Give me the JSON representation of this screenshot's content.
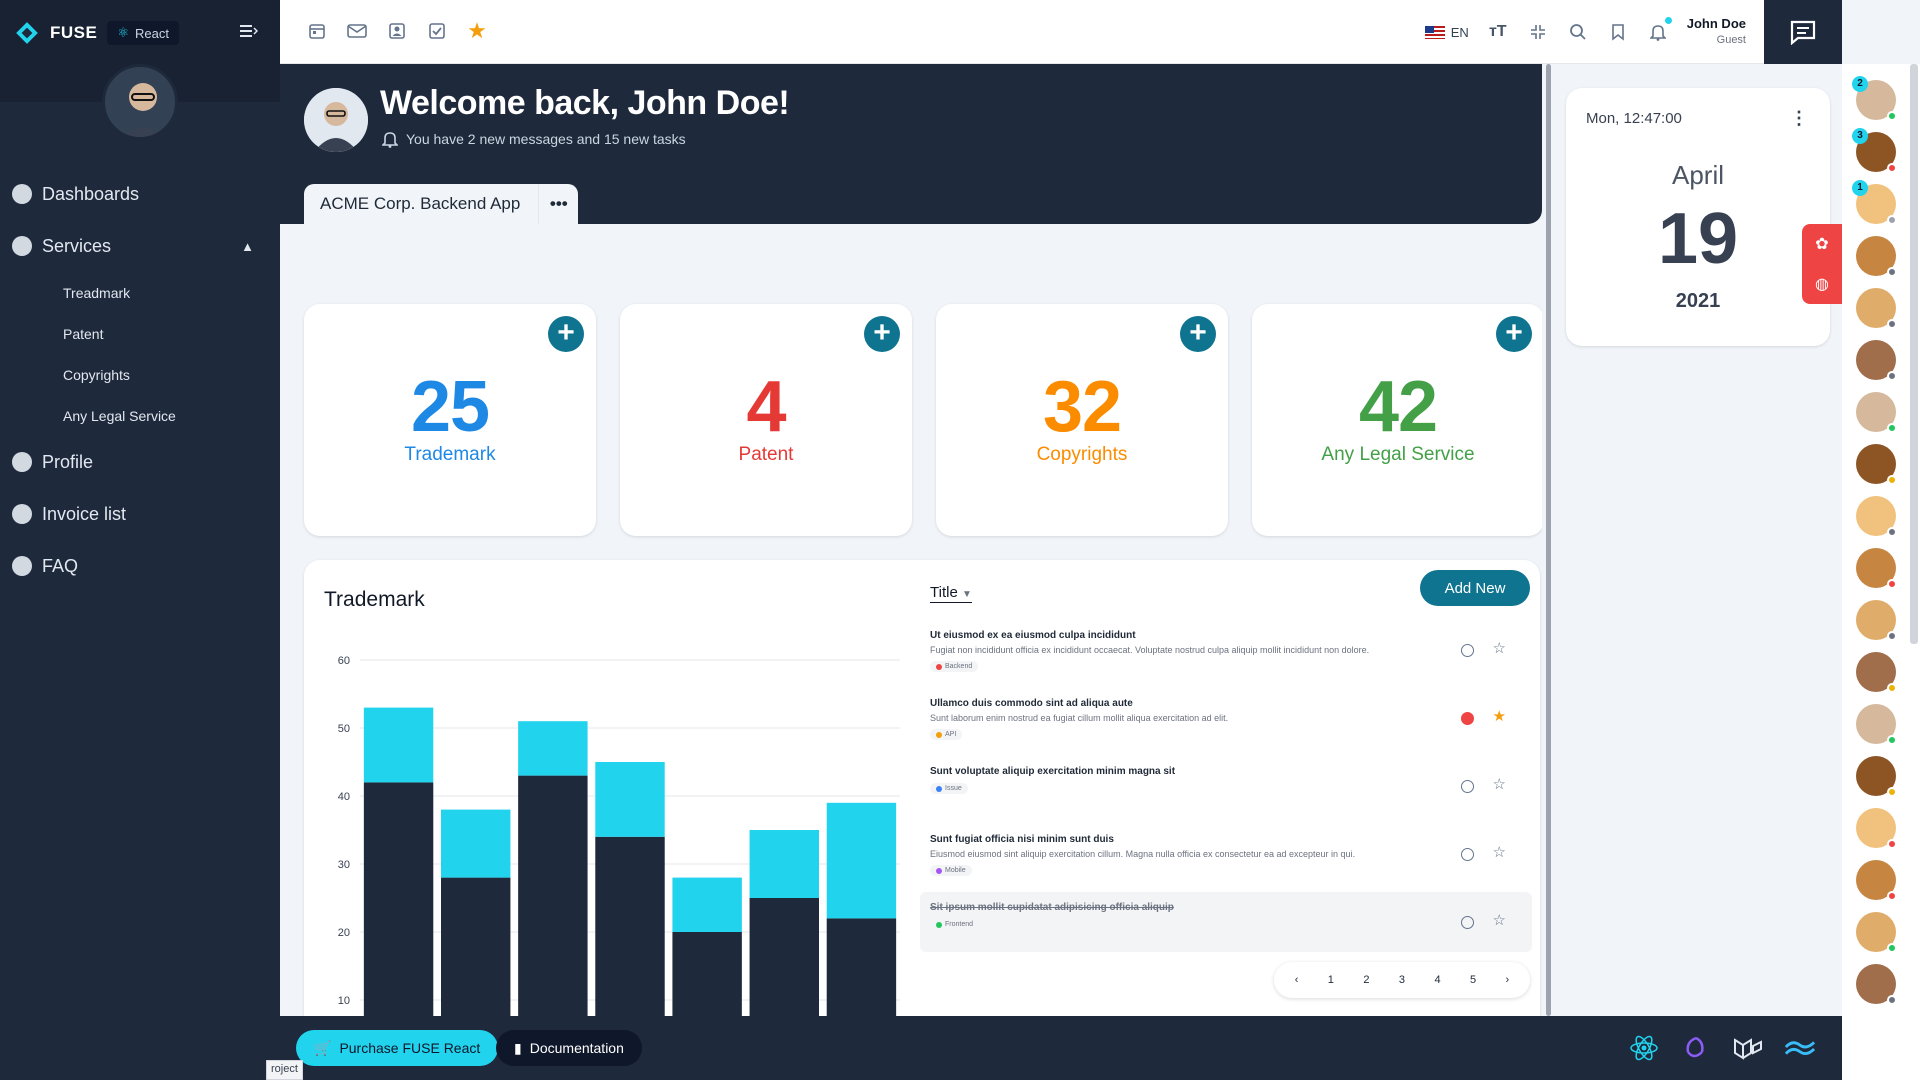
{
  "sidebar": {
    "brand": "FUSE",
    "badge": "React",
    "items": [
      {
        "label": "Dashboards"
      },
      {
        "label": "Services",
        "expanded": true
      },
      {
        "label": "Profile"
      },
      {
        "label": "Invoice list"
      },
      {
        "label": "FAQ"
      }
    ],
    "sub_items": [
      {
        "label": "Treadmark"
      },
      {
        "label": "Patent"
      },
      {
        "label": "Copyrights"
      },
      {
        "label": "Any Legal Service"
      }
    ]
  },
  "topbar": {
    "icons": [
      "calendar-icon",
      "mail-icon",
      "contacts-icon",
      "tasks-icon",
      "star-icon"
    ],
    "language": "EN",
    "user_name": "John Doe",
    "user_role": "Guest"
  },
  "hero": {
    "title": "Welcome back, John Doe!",
    "subtitle": "You have 2 new messages and 15 new tasks",
    "project": "ACME Corp. Backend App",
    "more": "•••"
  },
  "cards": [
    {
      "value": "25",
      "label": "Trademark",
      "color": "#1e88e5"
    },
    {
      "value": "4",
      "label": "Patent",
      "color": "#e53935"
    },
    {
      "value": "32",
      "label": "Copyrights",
      "color": "#fb8c00"
    },
    {
      "value": "42",
      "label": "Any Legal Service",
      "color": "#43a047"
    }
  ],
  "panel": {
    "title": "Trademark",
    "filter_label": "Title",
    "add_button": "Add New"
  },
  "chart_data": {
    "type": "bar",
    "stacked": true,
    "title": "",
    "xlabel": "",
    "ylabel": "",
    "ylim": [
      0,
      60
    ],
    "yticks": [
      10,
      20,
      30,
      40,
      50,
      60
    ],
    "grid": true,
    "series": [
      {
        "values": [
          42,
          28,
          43,
          34,
          20,
          25,
          22
        ],
        "color": "#1e293b"
      },
      {
        "values": [
          11,
          10,
          8,
          11,
          8,
          10,
          17
        ],
        "color": "#22d3ee"
      }
    ]
  },
  "tasks": [
    {
      "title": "Ut eiusmod ex ea eiusmod culpa incididunt",
      "desc": "Fugiat non incididunt officia ex incididunt occaecat. Voluptate nostrud culpa aliquip mollit incididunt non dolore.",
      "tag": "Backend",
      "tag_color": "#ef4444",
      "important": false,
      "starred": false,
      "done": false
    },
    {
      "title": "Ullamco duis commodo sint ad aliqua aute",
      "desc": "Sunt laborum enim nostrud ea fugiat cillum mollit aliqua exercitation ad elit.",
      "tag": "API",
      "tag_color": "#f59e0b",
      "important": true,
      "starred": true,
      "done": false
    },
    {
      "title": "Sunt voluptate aliquip exercitation minim magna sit",
      "desc": "",
      "tag": "Issue",
      "tag_color": "#3b82f6",
      "important": false,
      "starred": false,
      "done": false
    },
    {
      "title": "Sunt fugiat officia nisi minim sunt duis",
      "desc": "Eiusmod eiusmod sint aliquip exercitation cillum. Magna nulla officia ex consectetur ea ad excepteur in qui.",
      "tag": "Mobile",
      "tag_color": "#a855f7",
      "important": false,
      "starred": false,
      "done": false
    },
    {
      "title": "Sit ipsum mollit cupidatat adipisicing officia aliquip",
      "desc": "",
      "tag": "Frontend",
      "tag_color": "#22c55e",
      "important": false,
      "starred": false,
      "done": true
    }
  ],
  "pager": [
    "‹",
    "1",
    "2",
    "3",
    "4",
    "5",
    "›"
  ],
  "clock": {
    "time": "Mon, 12:47:00",
    "month": "April",
    "day": "19",
    "year": "2021"
  },
  "contacts": [
    {
      "badge": "2",
      "status": "#22c55e"
    },
    {
      "badge": "3",
      "status": "#ef4444"
    },
    {
      "badge": "1",
      "status": "#9ca3af"
    },
    {
      "badge": "",
      "status": "#6b7280"
    },
    {
      "badge": "",
      "status": "#6b7280"
    },
    {
      "badge": "",
      "status": "#6b7280"
    },
    {
      "badge": "",
      "status": "#22c55e"
    },
    {
      "badge": "",
      "status": "#eab308"
    },
    {
      "badge": "",
      "status": "#6b7280"
    },
    {
      "badge": "",
      "status": "#ef4444"
    },
    {
      "badge": "",
      "status": "#6b7280"
    },
    {
      "badge": "",
      "status": "#eab308"
    },
    {
      "badge": "",
      "status": "#22c55e"
    },
    {
      "badge": "",
      "status": "#eab308"
    },
    {
      "badge": "",
      "status": "#ef4444"
    },
    {
      "badge": "",
      "status": "#ef4444"
    },
    {
      "badge": "",
      "status": "#22c55e"
    },
    {
      "badge": "",
      "status": "#6b7280"
    }
  ],
  "footer": {
    "purchase": "Purchase FUSE React",
    "docs": "Documentation",
    "logos": [
      "react-logo-icon",
      "redux-logo-icon",
      "mui-logo-icon",
      "tailwind-logo-icon"
    ],
    "project_chip": "roject"
  }
}
